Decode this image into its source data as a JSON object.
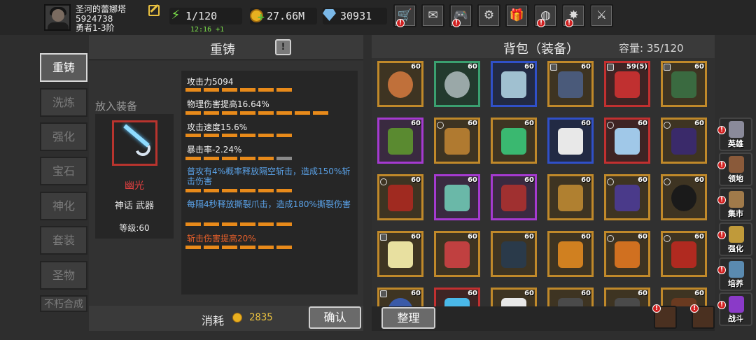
{
  "player": {
    "name": "圣河的蕾娜塔",
    "id": "5924738",
    "rank": "勇者1-3阶"
  },
  "resources": {
    "energy": "1/120",
    "timer": "12:16 +1",
    "gold": "27.66M",
    "gems": "30931"
  },
  "top_icons": [
    "shop-cart-icon",
    "mail-icon",
    "gamepad-icon",
    "settings-gear-icon",
    "gift-icon",
    "color-wheel-icon",
    "firework-icon",
    "crossed-swords-icon"
  ],
  "left_tabs": [
    "重铸",
    "洗炼",
    "强化",
    "宝石",
    "神化",
    "套装",
    "圣物",
    "不朽合成"
  ],
  "reforge": {
    "title": "重铸",
    "place_label": "放入装备",
    "equip_name": "幽光",
    "equip_type": "神话 武器",
    "equip_level": "等级:60",
    "stats": [
      {
        "text": "攻击力5094",
        "bars": 6,
        "grey": 0
      },
      {
        "text": "物理伤害提高16.64%",
        "bars": 8,
        "grey": 0
      },
      {
        "text": "攻击速度15.6%",
        "bars": 6,
        "grey": 0
      },
      {
        "text": "暴击率-2.24%",
        "bars": 5,
        "grey": 1
      },
      {
        "text": "普攻有4%概率释放隔空斩击，造成150%斩击伤害",
        "bars": 6,
        "grey": 0
      },
      {
        "text": "每隔4秒释放撕裂爪击，造成180%撕裂伤害",
        "bars": 6,
        "grey": 0
      },
      {
        "text": "斩击伤害提高20%",
        "bars": 6,
        "grey": 0
      }
    ],
    "cost_label": "消耗",
    "cost_value": "2835",
    "confirm": "确认"
  },
  "bag": {
    "title": "背包（装备）",
    "capacity": "容量: 35/120",
    "sort": "整理",
    "items": [
      {
        "lv": "60",
        "rarity": "orange",
        "icon": "ring-icon",
        "c": "#c0703a"
      },
      {
        "lv": "60",
        "rarity": "green",
        "icon": "ring-icon",
        "c": "#9aa8a8"
      },
      {
        "lv": "60",
        "rarity": "blue",
        "icon": "boots-icon",
        "c": "#a0c0d0"
      },
      {
        "lv": "60",
        "rarity": "orange",
        "icon": "armor-icon",
        "c": "#4a5a7a",
        "lock": true
      },
      {
        "lv": "59",
        "extra": "(5)",
        "rarity": "red",
        "icon": "armor-icon",
        "c": "#c03030",
        "lock": true
      },
      {
        "lv": "60",
        "rarity": "orange",
        "icon": "bow-icon",
        "c": "#3a6a40",
        "lock": true
      },
      {
        "lv": "60",
        "rarity": "purple",
        "icon": "gloves-icon",
        "c": "#5a8a30"
      },
      {
        "lv": "60",
        "rarity": "orange",
        "icon": "armor-icon",
        "c": "#b07a30",
        "dot": true
      },
      {
        "lv": "60",
        "rarity": "orange",
        "icon": "necklace-icon",
        "c": "#3ab870"
      },
      {
        "lv": "60",
        "rarity": "blue",
        "icon": "sword-icon",
        "c": "#e8e8e8"
      },
      {
        "lv": "60",
        "rarity": "red",
        "icon": "blade-icon",
        "c": "#a0c8e8",
        "dot": true
      },
      {
        "lv": "60",
        "rarity": "orange",
        "icon": "gloves-icon",
        "c": "#3a2a6a",
        "dot": true
      },
      {
        "lv": "60",
        "rarity": "orange",
        "icon": "armor-icon",
        "c": "#a02a20",
        "dot": true
      },
      {
        "lv": "60",
        "rarity": "purple",
        "icon": "armor-icon",
        "c": "#6ab8a8"
      },
      {
        "lv": "60",
        "rarity": "purple",
        "icon": "necklace-icon",
        "c": "#a03030"
      },
      {
        "lv": "60",
        "rarity": "orange",
        "icon": "staff-icon",
        "c": "#b08030"
      },
      {
        "lv": "60",
        "rarity": "orange",
        "icon": "gloves-icon",
        "c": "#4a3a8a",
        "dot": true
      },
      {
        "lv": "60",
        "rarity": "orange",
        "icon": "ring-icon",
        "c": "#1a1a1a",
        "dot": true
      },
      {
        "lv": "60",
        "rarity": "orange",
        "icon": "cloak-icon",
        "c": "#e8e0a0",
        "lock": true
      },
      {
        "lv": "60",
        "rarity": "orange",
        "icon": "axe-icon",
        "c": "#c04040"
      },
      {
        "lv": "60",
        "rarity": "orange",
        "icon": "armor-icon",
        "c": "#2a3a4a"
      },
      {
        "lv": "60",
        "rarity": "orange",
        "icon": "book-icon",
        "c": "#d08020"
      },
      {
        "lv": "60",
        "rarity": "orange",
        "icon": "armor-icon",
        "c": "#d07020",
        "dot": true
      },
      {
        "lv": "60",
        "rarity": "orange",
        "icon": "armor-icon",
        "c": "#b02a20",
        "dot": true
      },
      {
        "lv": "60",
        "rarity": "orange",
        "icon": "ring-icon",
        "c": "#3a5aa8",
        "lock": true
      },
      {
        "lv": "60",
        "rarity": "red",
        "icon": "blade-icon",
        "c": "#4ab8e8"
      },
      {
        "lv": "60",
        "rarity": "orange",
        "icon": "necklace-icon",
        "c": "#e8e8e8"
      },
      {
        "lv": "60",
        "rarity": "orange",
        "icon": "armor-icon",
        "c": "#4a4a4a"
      },
      {
        "lv": "60",
        "rarity": "orange",
        "icon": "armor-icon",
        "c": "#4a4a4a"
      },
      {
        "lv": "60",
        "rarity": "orange",
        "icon": "armor-icon",
        "c": "#6a3a20"
      }
    ]
  },
  "side_menu": [
    {
      "label": "英雄",
      "icon": "hero-helmet-icon",
      "c": "#8a8a9a"
    },
    {
      "label": "领地",
      "icon": "castle-icon",
      "c": "#8a5a3a"
    },
    {
      "label": "集市",
      "icon": "market-stall-icon",
      "c": "#a07a4a"
    },
    {
      "label": "强化",
      "icon": "forge-icon",
      "c": "#c09a3a"
    },
    {
      "label": "培养",
      "icon": "potion-icon",
      "c": "#5a8ab0"
    },
    {
      "label": "战斗",
      "icon": "portal-icon",
      "c": "#8a3ac8"
    }
  ]
}
